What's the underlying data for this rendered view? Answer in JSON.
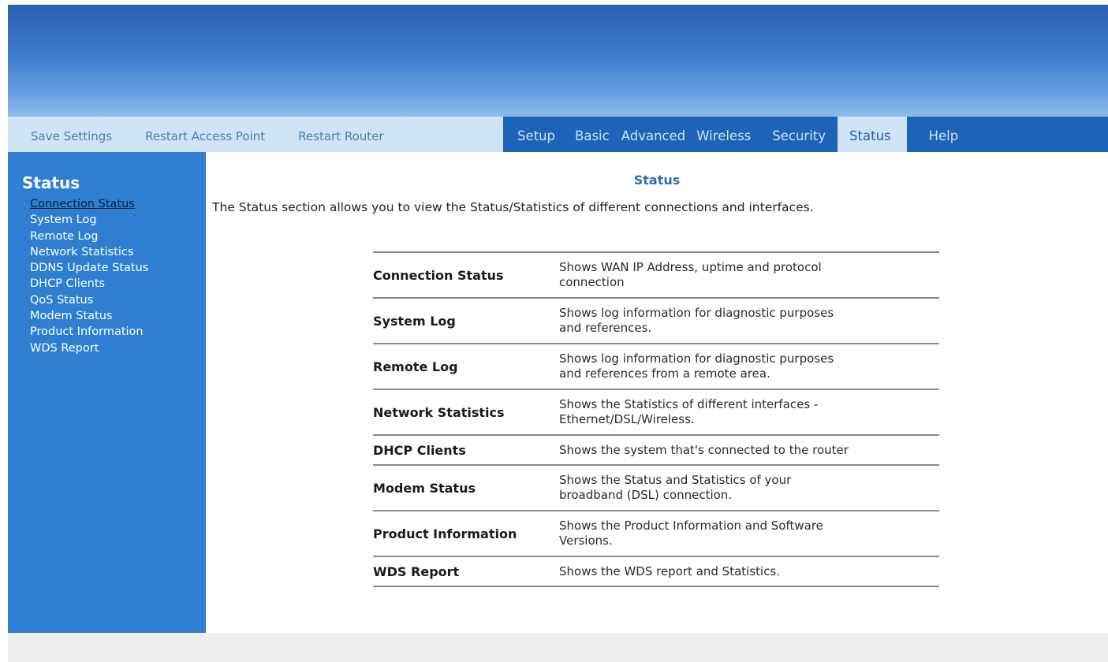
{
  "nav": {
    "left_links": [
      "Save Settings",
      "Restart Access Point",
      "Restart Router"
    ],
    "tabs": [
      "Setup",
      "Basic",
      "Advanced",
      "Wireless",
      "Security",
      "Status",
      "Help"
    ],
    "active_tab": "Status"
  },
  "sidebar": {
    "title": "Status",
    "items": [
      "Connection Status",
      "System Log",
      "Remote Log",
      "Network Statistics",
      "DDNS Update Status",
      "DHCP Clients",
      "QoS Status",
      "Modem Status",
      "Product Information",
      "WDS Report"
    ],
    "current_item": "Connection Status"
  },
  "main": {
    "title": "Status",
    "intro": "The Status section allows you to view the Status/Statistics of different connections and interfaces.",
    "rows": [
      {
        "name": "Connection Status",
        "desc1": "Shows WAN IP Address, uptime and protocol",
        "desc2": "connection"
      },
      {
        "name": "System Log",
        "desc1": "Shows log information for diagnostic purposes",
        "desc2": "and references."
      },
      {
        "name": "Remote Log",
        "desc1": "Shows log information for diagnostic purposes",
        "desc2": "and references from a remote area."
      },
      {
        "name": "Network Statistics",
        "desc1": "Shows the Statistics of different interfaces -",
        "desc2": "Ethernet/DSL/Wireless."
      },
      {
        "name": "DHCP Clients",
        "desc1": "Shows the system that's connected to the router",
        "desc2": ""
      },
      {
        "name": "Modem Status",
        "desc1": "Shows the Status and Statistics of your",
        "desc2": "broadband (DSL) connection."
      },
      {
        "name": "Product Information",
        "desc1": "Shows the Product Information and Software",
        "desc2": "Versions."
      },
      {
        "name": "WDS Report",
        "desc1": "Shows the WDS report and Statistics.",
        "desc2": ""
      }
    ]
  },
  "colors": {
    "banner_top": "#2c5fb0",
    "banner_bottom": "#8fbde9",
    "nav_light": "#cfe4f6",
    "nav_dark": "#1d63b8",
    "sidebar": "#2e7fd2",
    "title_blue": "#2a6cb8",
    "footer": "#efefef"
  }
}
